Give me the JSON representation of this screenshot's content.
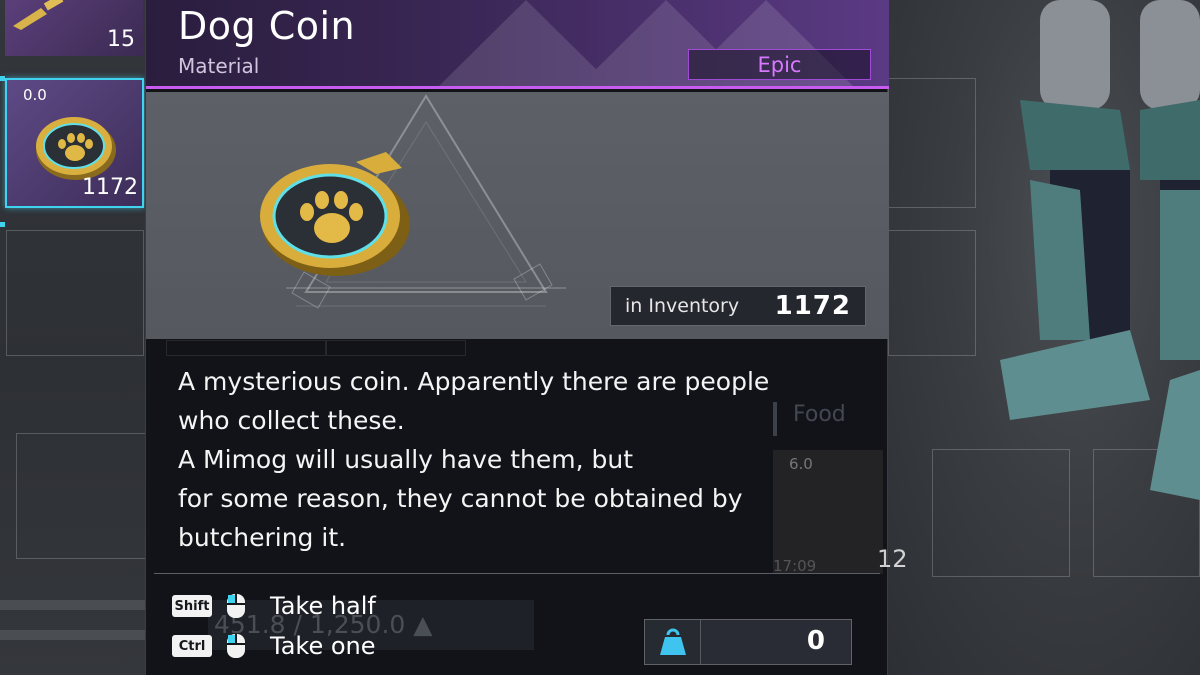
{
  "item": {
    "name": "Dog Coin",
    "category": "Material",
    "rarity": "Epic",
    "rarity_color": "#d778ff",
    "description": [
      "A mysterious coin. Apparently there are people",
      "who collect these.",
      "A Mimog will usually have them, but",
      "for some reason, they cannot be obtained by",
      "butchering it."
    ],
    "icon": "paw-coin-icon"
  },
  "inventory": {
    "label": "in Inventory",
    "count": "1172"
  },
  "actions": [
    {
      "key": "Shift",
      "mouse": "mouse-icon",
      "label": "Take half"
    },
    {
      "key": "Ctrl",
      "mouse": "mouse-icon",
      "label": "Take one"
    }
  ],
  "carry": {
    "icon": "weight-icon",
    "value": "0"
  },
  "left_slots": {
    "key_slot_qty": "15",
    "coin_slot_weight": "0.0",
    "coin_slot_qty": "1172"
  },
  "background_faint": {
    "category_label": "Food",
    "slot_weight": "6.0",
    "slot_qty": "12",
    "slot_timer": "17:09",
    "weight_readout": "451.8 / 1,250.0 ▲"
  },
  "colors": {
    "accent": "#3fd3f0",
    "header_border": "#c85cf0",
    "panel_bg": "#111318"
  }
}
